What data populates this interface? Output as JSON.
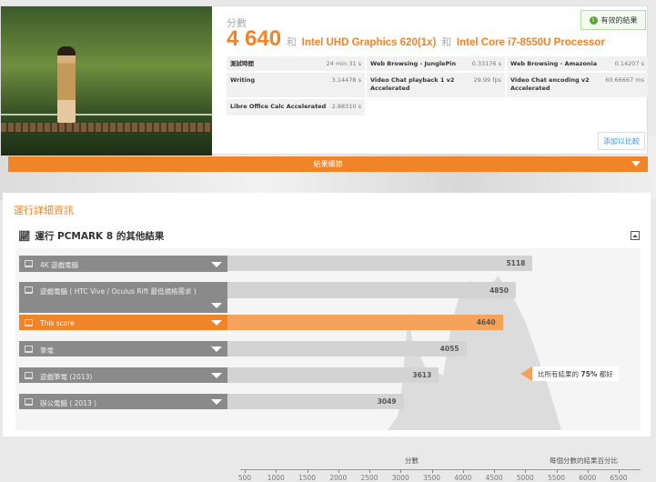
{
  "result": {
    "score_label": "分數",
    "score": "4 640",
    "and": "和",
    "gpu": "Intel UHD Graphics 620(1x)",
    "cpu": "Intel Core i7-8550U Processor",
    "valid_label": "有效的結果",
    "compare_button": "添加以比較",
    "details": [
      {
        "name": "測試時間",
        "value": "24 min 31 s"
      },
      {
        "name": "Web Browsing - JunglePin",
        "value": "0.33176 s"
      },
      {
        "name": "Web Browsing - Amazonia",
        "value": "0.14207 s"
      },
      {
        "name": "Writing",
        "value": "3.14478 s"
      },
      {
        "name": "Video Chat playback 1 v2 Accelerated",
        "value": "29.99 fps"
      },
      {
        "name": "Video Chat encoding v2 Accelerated",
        "value": "60.66667 ms"
      },
      {
        "name": "Libre Office Calc Accelerated",
        "value": "2.88310 s"
      }
    ]
  },
  "details_bar": "結果細節",
  "section": {
    "title": "運行詳細資訊",
    "subtitle": "運行 PCMARK 8 的其他結果"
  },
  "chart": {
    "rows": [
      {
        "label": "4K 遊戲電腦",
        "value": 5118
      },
      {
        "label": "遊戲電腦 ( HTC Vive / Oculus Rift 最低規格需求 )",
        "value": 4850
      },
      {
        "label": "This score",
        "value": 4640
      },
      {
        "label": "筆電",
        "value": 4055
      },
      {
        "label": "遊戲筆電 (2013)",
        "value": 3613
      },
      {
        "label": "辦公電腦 ( 2013 )",
        "value": 3049
      }
    ],
    "tooltip_prefix": "比所有結果的",
    "tooltip_pct": "75%",
    "tooltip_suffix": "都好",
    "xlabel": "分數",
    "ylabel": "每個分數的結果百分比",
    "ticks": [
      500,
      1000,
      1500,
      2000,
      2500,
      3000,
      3500,
      4000,
      4500,
      5000,
      5500,
      6000,
      6500
    ],
    "accent": "#f08428"
  }
}
